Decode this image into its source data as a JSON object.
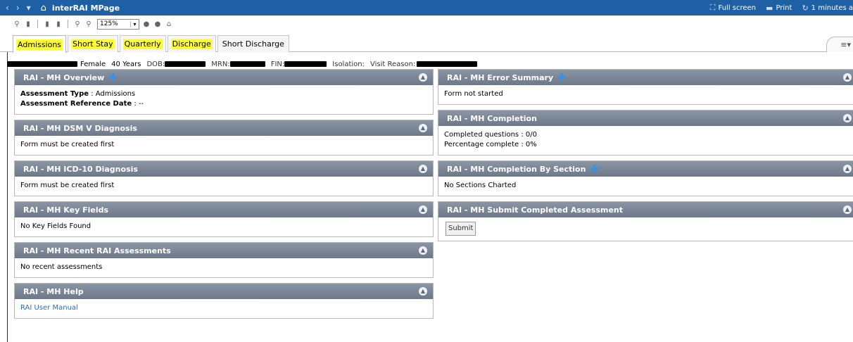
{
  "titlebar": {
    "title": "interRAI MPage",
    "back_glyph": "‹",
    "forward_glyph": "›",
    "dropdown_glyph": "▾",
    "home_glyph": "⌂",
    "fullscreen_label": "Full screen",
    "print_label": "Print",
    "refresh_label": "1 minutes a",
    "accent": "#1f5fa3"
  },
  "toolbar": {
    "zoom": "125%",
    "icons": [
      "binoculars-icon",
      "page-icon",
      "print-icon",
      "print-preview-icon",
      "zoom-in-icon",
      "zoom-out-icon",
      "circle-icon",
      "circle-icon",
      "home-icon"
    ]
  },
  "tabs": [
    {
      "label": "Admissions",
      "highlight": true
    },
    {
      "label": "Short Stay",
      "highlight": true
    },
    {
      "label": "Quarterly",
      "highlight": true
    },
    {
      "label": "Discharge",
      "highlight": true
    },
    {
      "label": "Short Discharge",
      "highlight": false
    }
  ],
  "tab_menu_glyph": "≡▾",
  "banner": {
    "sex": "Female",
    "age": "40 Years",
    "dob_label": "DOB:",
    "mrn_label": "MRN:",
    "fin_label": "FIN:",
    "isolation_label": "Isolation:",
    "visit_reason_label": "Visit Reason:"
  },
  "panels": {
    "overview": {
      "title": "RAI - MH Overview",
      "assessment_type_label": "Assessment Type",
      "assessment_type_value": " : Admissions",
      "ref_date_label": "Assessment Reference Date",
      "ref_date_value": " : --"
    },
    "dsm": {
      "title": "RAI - MH DSM V Diagnosis",
      "body": "Form must be created first"
    },
    "icd": {
      "title": "RAI - MH ICD-10 Diagnosis",
      "body": "Form must be created first"
    },
    "key_fields": {
      "title": "RAI - MH Key Fields",
      "body": "No Key Fields Found"
    },
    "recent": {
      "title": "RAI - MH Recent RAI Assessments",
      "body": "No recent assessments"
    },
    "help": {
      "title": "RAI - MH Help",
      "link": "RAI User Manual"
    },
    "error_summary": {
      "title": "RAI - MH Error Summary",
      "body": "Form not started"
    },
    "completion": {
      "title": "RAI - MH Completion",
      "line1": "Completed questions : 0/0",
      "line2": "Percentage complete : 0%"
    },
    "completion_by_section": {
      "title": "RAI - MH Completion By Section",
      "body": "No Sections Charted"
    },
    "submit": {
      "title": "RAI - MH Submit Completed Assessment",
      "button": "Submit"
    }
  },
  "glyphs": {
    "plus": "✚",
    "collapse": "▲"
  }
}
